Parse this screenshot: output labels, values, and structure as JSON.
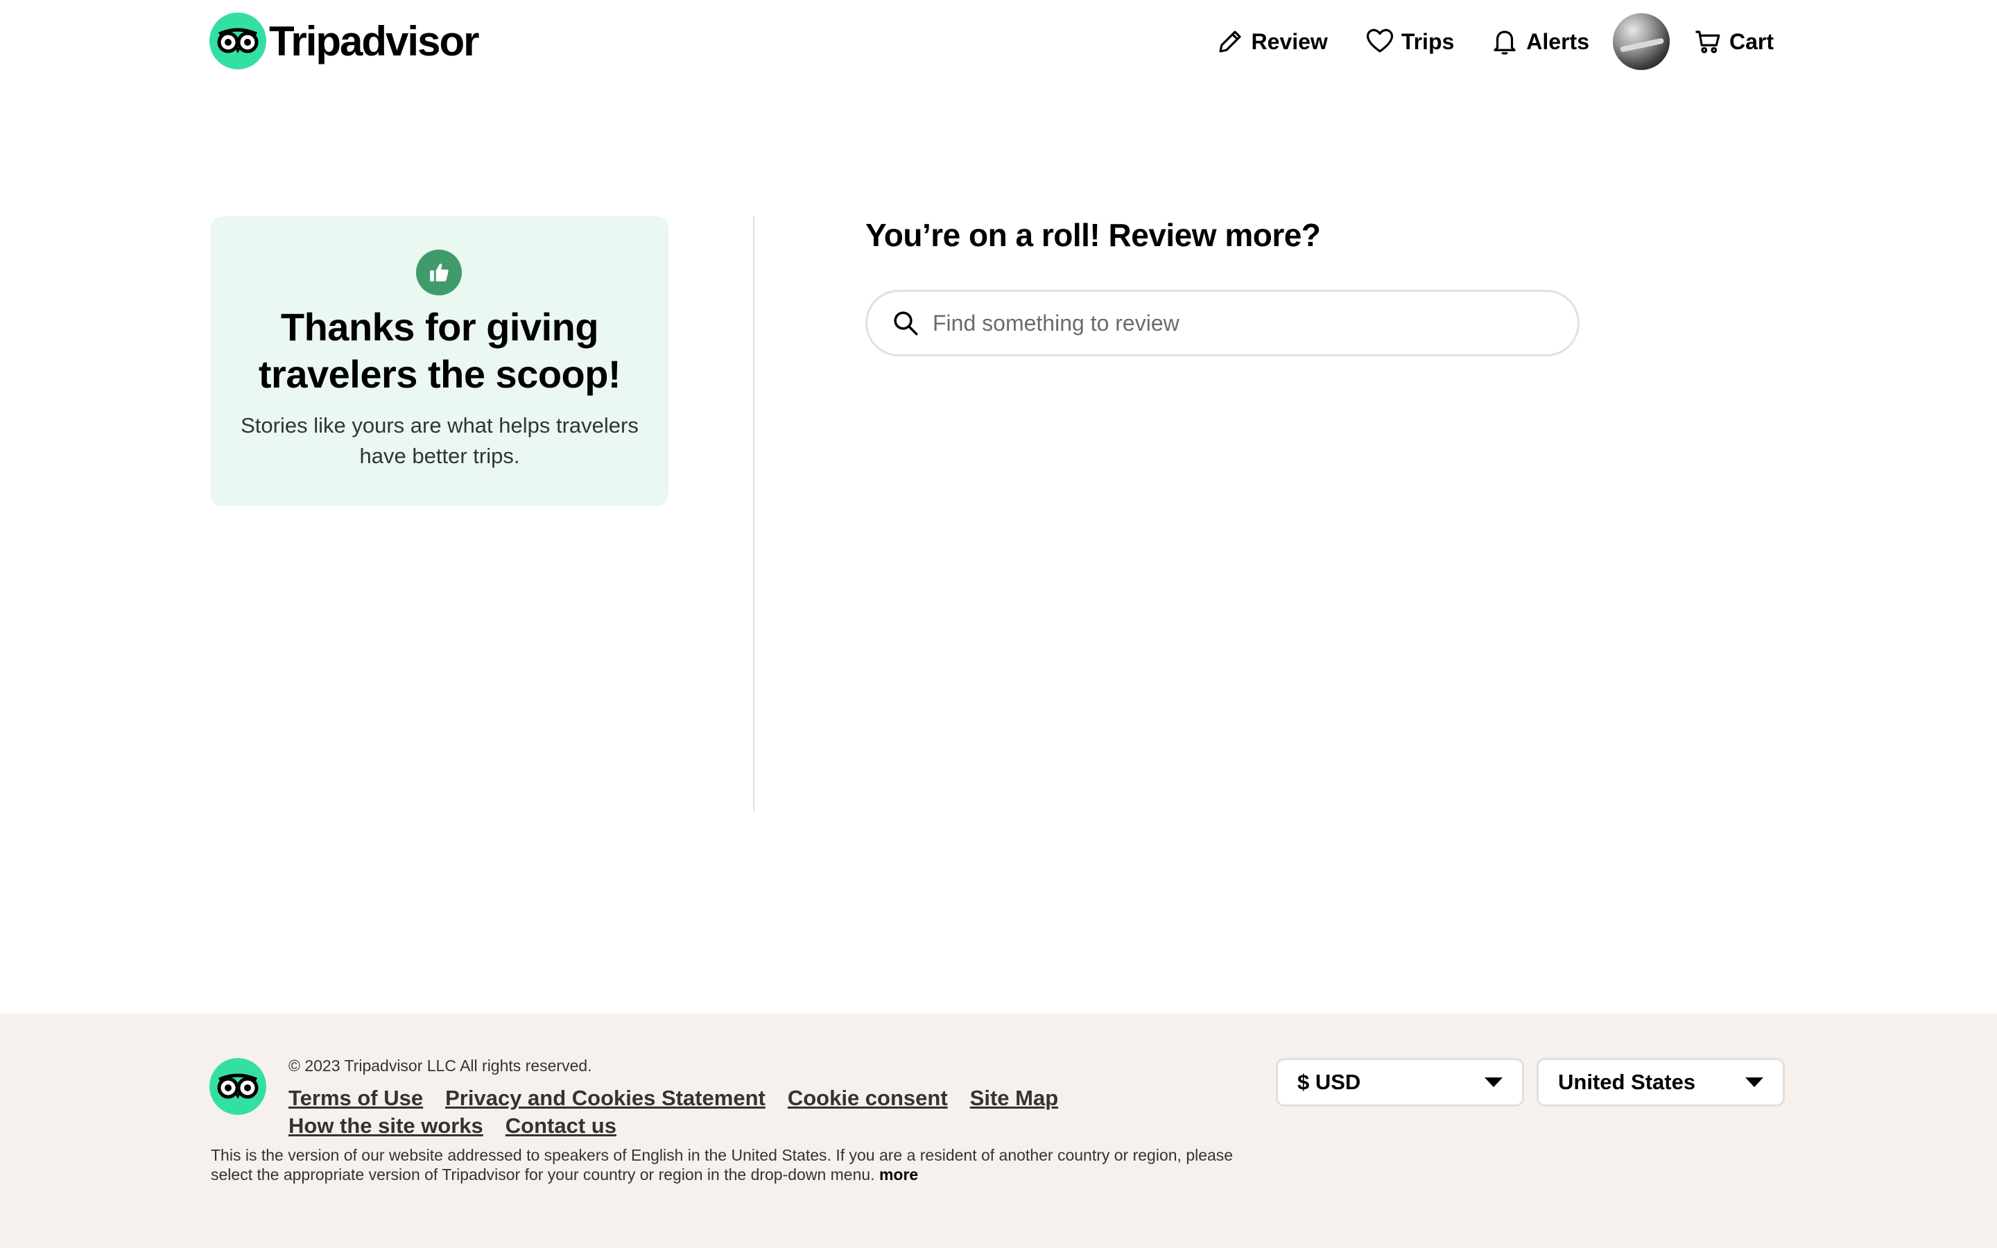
{
  "header": {
    "logo_text": "Tripadvisor",
    "nav": {
      "review_label": "Review",
      "trips_label": "Trips",
      "alerts_label": "Alerts",
      "cart_label": "Cart"
    }
  },
  "main": {
    "thanks_title": "Thanks for giving travelers the scoop!",
    "thanks_subtitle": "Stories like yours are what helps travelers have better trips.",
    "review_more_heading": "You’re on a roll! Review more?",
    "search": {
      "value": "",
      "placeholder": "Find something to review"
    }
  },
  "footer": {
    "copyright": "© 2023 Tripadvisor LLC All rights reserved.",
    "links_row_1": [
      "Terms of Use",
      "Privacy and Cookies Statement",
      "Cookie consent",
      "Site Map"
    ],
    "links_row_2": [
      "How the site works",
      "Contact us"
    ],
    "disclaimer": "This is the version of our website addressed to speakers of English in the United States. If you are a resident of another country or region, please select the appropriate version of Tripadvisor for your country or region in the drop-down menu.",
    "disclaimer_more": "more",
    "currency_selected": "$ USD",
    "country_selected": "United States"
  },
  "colors": {
    "brand_green": "#34e0a1",
    "thumb_badge": "#3f9c6a",
    "card_bg": "#ebf7f1",
    "footer_bg": "#f7f1ed"
  },
  "icons": {
    "logo": "owl-eyes-icon",
    "review": "pencil-icon",
    "trips": "heart-icon",
    "alerts": "bell-icon",
    "cart": "cart-icon",
    "search": "search-icon",
    "thanks": "thumbs-up-icon",
    "dropdown": "caret-down-icon"
  }
}
